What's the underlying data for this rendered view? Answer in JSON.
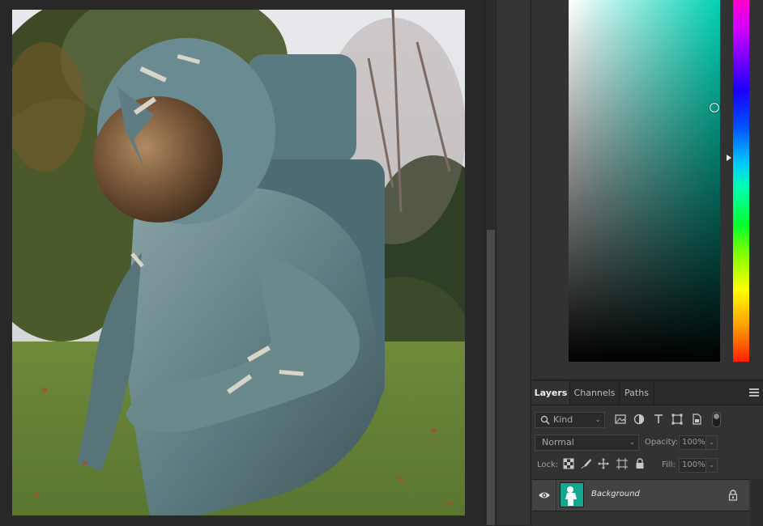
{
  "layers_panel": {
    "tabs": [
      {
        "label": "Layers",
        "active": true
      },
      {
        "label": "Channels",
        "active": false
      },
      {
        "label": "Paths",
        "active": false
      }
    ],
    "filter": {
      "kind_label": "Kind"
    },
    "blend_mode": "Normal",
    "opacity_label": "Opacity:",
    "opacity_value": "100%",
    "lock_label": "Lock:",
    "fill_label": "Fill:",
    "fill_value": "100%",
    "layers": [
      {
        "name": "Background",
        "visible": true,
        "locked": true
      }
    ]
  },
  "color_panel": {
    "hue_color": "#00d1b4"
  },
  "icons": {
    "filter_icons": [
      "image-filter-icon",
      "adjustment-filter-icon",
      "type-filter-icon",
      "shape-filter-icon",
      "smart-object-filter-icon"
    ],
    "lock_icons": [
      "lock-transparent-pixels-icon",
      "lock-image-pixels-icon",
      "lock-position-icon",
      "lock-artboard-icon",
      "lock-all-icon"
    ]
  }
}
